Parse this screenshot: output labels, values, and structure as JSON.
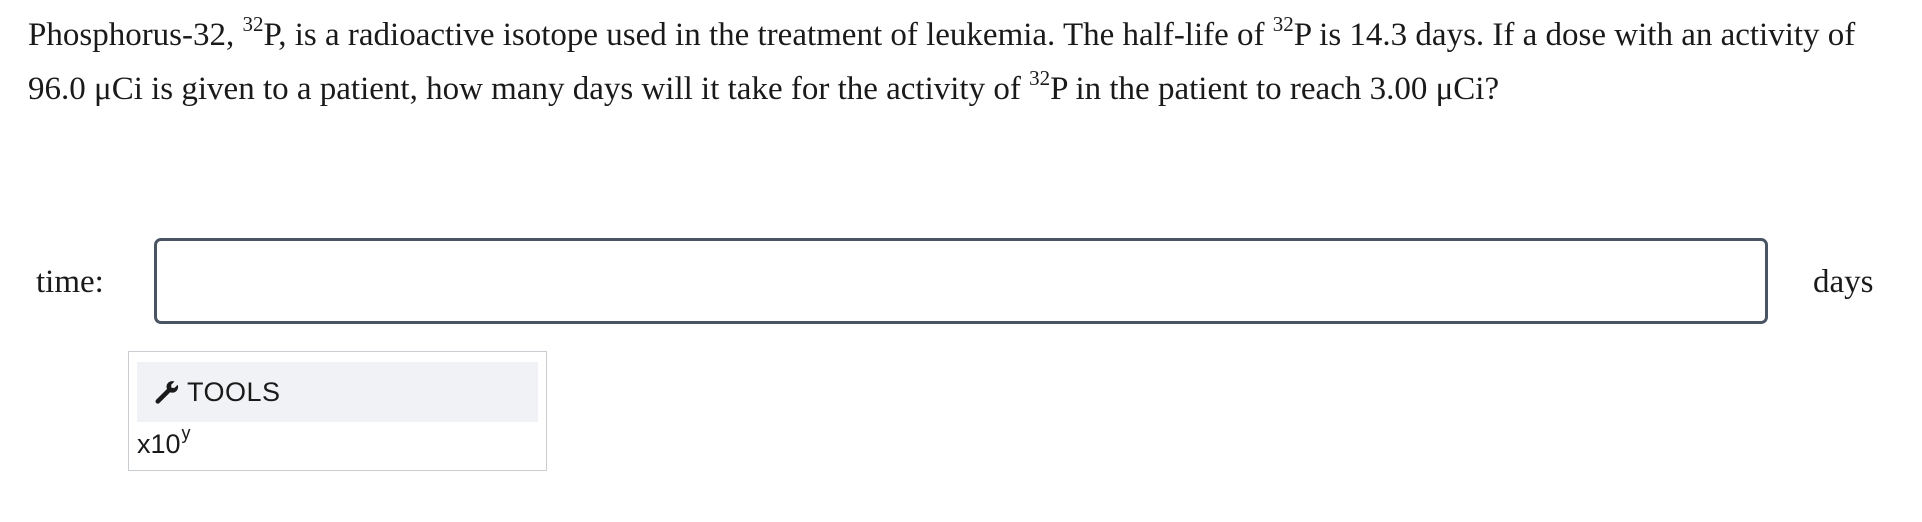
{
  "question": {
    "part1": "Phosphorus-32, ",
    "sup1": "32",
    "part2": "P, is a radioactive isotope used in the treatment of leukemia. The half-life of ",
    "sup2": "32",
    "part3": "P is 14.3 days. If a dose with an activity of 96.0 μCi is given to a patient, how many days will it take for the activity of ",
    "sup3": "32",
    "part4": "P in the patient to reach 3.00 μCi?"
  },
  "answer": {
    "label": "time:",
    "value": "",
    "placeholder": "",
    "unit": "days"
  },
  "tools": {
    "header_label": "TOOLS",
    "header_icon": "wrench-icon",
    "x10_base": "x10",
    "x10_exponent": "y"
  },
  "colors": {
    "input_border": "#4a5563",
    "tools_header_bg": "#f1f2f5",
    "tools_border": "#c9ccd1"
  }
}
